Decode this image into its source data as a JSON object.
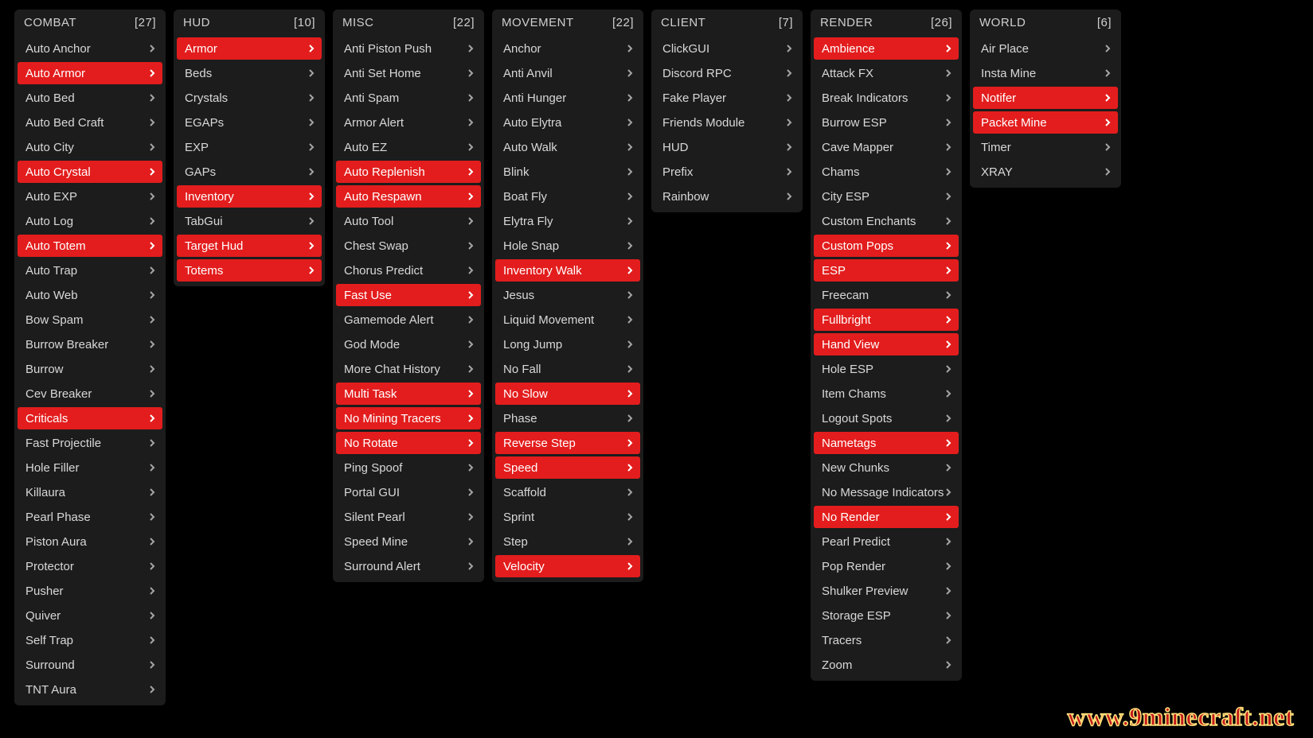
{
  "watermark": "www.9minecraft.net",
  "panels": [
    {
      "title": "COMBAT",
      "count": "[27]",
      "modules": [
        {
          "name": "Auto Anchor",
          "active": false,
          "chevron": true
        },
        {
          "name": "Auto Armor",
          "active": true,
          "chevron": true
        },
        {
          "name": "Auto Bed",
          "active": false,
          "chevron": true
        },
        {
          "name": "Auto Bed Craft",
          "active": false,
          "chevron": true
        },
        {
          "name": "Auto City",
          "active": false,
          "chevron": true
        },
        {
          "name": "Auto Crystal",
          "active": true,
          "chevron": true
        },
        {
          "name": "Auto EXP",
          "active": false,
          "chevron": true
        },
        {
          "name": "Auto Log",
          "active": false,
          "chevron": true
        },
        {
          "name": "Auto Totem",
          "active": true,
          "chevron": true
        },
        {
          "name": "Auto Trap",
          "active": false,
          "chevron": true
        },
        {
          "name": "Auto Web",
          "active": false,
          "chevron": true
        },
        {
          "name": "Bow Spam",
          "active": false,
          "chevron": true
        },
        {
          "name": "Burrow Breaker",
          "active": false,
          "chevron": true
        },
        {
          "name": "Burrow",
          "active": false,
          "chevron": true
        },
        {
          "name": "Cev Breaker",
          "active": false,
          "chevron": true
        },
        {
          "name": "Criticals",
          "active": true,
          "chevron": true
        },
        {
          "name": "Fast Projectile",
          "active": false,
          "chevron": true
        },
        {
          "name": "Hole Filler",
          "active": false,
          "chevron": true
        },
        {
          "name": "Killaura",
          "active": false,
          "chevron": true
        },
        {
          "name": "Pearl Phase",
          "active": false,
          "chevron": true
        },
        {
          "name": "Piston Aura",
          "active": false,
          "chevron": true
        },
        {
          "name": "Protector",
          "active": false,
          "chevron": true
        },
        {
          "name": "Pusher",
          "active": false,
          "chevron": true
        },
        {
          "name": "Quiver",
          "active": false,
          "chevron": true
        },
        {
          "name": "Self Trap",
          "active": false,
          "chevron": true
        },
        {
          "name": "Surround",
          "active": false,
          "chevron": true
        },
        {
          "name": "TNT Aura",
          "active": false,
          "chevron": true
        }
      ]
    },
    {
      "title": "HUD",
      "count": "[10]",
      "modules": [
        {
          "name": "Armor",
          "active": true,
          "chevron": true
        },
        {
          "name": "Beds",
          "active": false,
          "chevron": true
        },
        {
          "name": "Crystals",
          "active": false,
          "chevron": true
        },
        {
          "name": "EGAPs",
          "active": false,
          "chevron": true
        },
        {
          "name": "EXP",
          "active": false,
          "chevron": true
        },
        {
          "name": "GAPs",
          "active": false,
          "chevron": true
        },
        {
          "name": "Inventory",
          "active": true,
          "chevron": true
        },
        {
          "name": "TabGui",
          "active": false,
          "chevron": true
        },
        {
          "name": "Target Hud",
          "active": true,
          "chevron": true
        },
        {
          "name": "Totems",
          "active": true,
          "chevron": true
        }
      ]
    },
    {
      "title": "MISC",
      "count": "[22]",
      "modules": [
        {
          "name": "Anti Piston Push",
          "active": false,
          "chevron": true
        },
        {
          "name": "Anti Set Home",
          "active": false,
          "chevron": true
        },
        {
          "name": "Anti Spam",
          "active": false,
          "chevron": true
        },
        {
          "name": "Armor Alert",
          "active": false,
          "chevron": true
        },
        {
          "name": "Auto EZ",
          "active": false,
          "chevron": true
        },
        {
          "name": "Auto Replenish",
          "active": true,
          "chevron": true
        },
        {
          "name": "Auto Respawn",
          "active": true,
          "chevron": true
        },
        {
          "name": "Auto Tool",
          "active": false,
          "chevron": true
        },
        {
          "name": "Chest Swap",
          "active": false,
          "chevron": true
        },
        {
          "name": "Chorus Predict",
          "active": false,
          "chevron": true
        },
        {
          "name": "Fast Use",
          "active": true,
          "chevron": true
        },
        {
          "name": "Gamemode Alert",
          "active": false,
          "chevron": true
        },
        {
          "name": "God Mode",
          "active": false,
          "chevron": true
        },
        {
          "name": "More Chat History",
          "active": false,
          "chevron": true
        },
        {
          "name": "Multi Task",
          "active": true,
          "chevron": true
        },
        {
          "name": "No Mining Tracers",
          "active": true,
          "chevron": true
        },
        {
          "name": "No Rotate",
          "active": true,
          "chevron": true
        },
        {
          "name": "Ping Spoof",
          "active": false,
          "chevron": true
        },
        {
          "name": "Portal GUI",
          "active": false,
          "chevron": true
        },
        {
          "name": "Silent Pearl",
          "active": false,
          "chevron": true
        },
        {
          "name": "Speed Mine",
          "active": false,
          "chevron": true
        },
        {
          "name": "Surround Alert",
          "active": false,
          "chevron": true
        }
      ]
    },
    {
      "title": "MOVEMENT",
      "count": "[22]",
      "modules": [
        {
          "name": "Anchor",
          "active": false,
          "chevron": true
        },
        {
          "name": "Anti Anvil",
          "active": false,
          "chevron": true
        },
        {
          "name": "Anti Hunger",
          "active": false,
          "chevron": true
        },
        {
          "name": "Auto Elytra",
          "active": false,
          "chevron": true
        },
        {
          "name": "Auto Walk",
          "active": false,
          "chevron": true
        },
        {
          "name": "Blink",
          "active": false,
          "chevron": true
        },
        {
          "name": "Boat Fly",
          "active": false,
          "chevron": true
        },
        {
          "name": "Elytra Fly",
          "active": false,
          "chevron": true
        },
        {
          "name": "Hole Snap",
          "active": false,
          "chevron": true
        },
        {
          "name": "Inventory Walk",
          "active": true,
          "chevron": true
        },
        {
          "name": "Jesus",
          "active": false,
          "chevron": true
        },
        {
          "name": "Liquid Movement",
          "active": false,
          "chevron": true
        },
        {
          "name": "Long Jump",
          "active": false,
          "chevron": true
        },
        {
          "name": "No Fall",
          "active": false,
          "chevron": true
        },
        {
          "name": "No Slow",
          "active": true,
          "chevron": true
        },
        {
          "name": "Phase",
          "active": false,
          "chevron": true
        },
        {
          "name": "Reverse Step",
          "active": true,
          "chevron": true
        },
        {
          "name": "Speed",
          "active": true,
          "chevron": true
        },
        {
          "name": "Scaffold",
          "active": false,
          "chevron": true
        },
        {
          "name": "Sprint",
          "active": false,
          "chevron": true
        },
        {
          "name": "Step",
          "active": false,
          "chevron": true
        },
        {
          "name": "Velocity",
          "active": true,
          "chevron": true
        }
      ]
    },
    {
      "title": "CLIENT",
      "count": "[7]",
      "modules": [
        {
          "name": "ClickGUI",
          "active": false,
          "chevron": true
        },
        {
          "name": "Discord RPC",
          "active": false,
          "chevron": true
        },
        {
          "name": "Fake Player",
          "active": false,
          "chevron": true
        },
        {
          "name": "Friends Module",
          "active": false,
          "chevron": true
        },
        {
          "name": "HUD",
          "active": false,
          "chevron": true
        },
        {
          "name": "Prefix",
          "active": false,
          "chevron": true
        },
        {
          "name": "Rainbow",
          "active": false,
          "chevron": true
        }
      ]
    },
    {
      "title": "RENDER",
      "count": "[26]",
      "modules": [
        {
          "name": "Ambience",
          "active": true,
          "chevron": true
        },
        {
          "name": "Attack FX",
          "active": false,
          "chevron": true
        },
        {
          "name": "Break Indicators",
          "active": false,
          "chevron": true
        },
        {
          "name": "Burrow ESP",
          "active": false,
          "chevron": true
        },
        {
          "name": "Cave Mapper",
          "active": false,
          "chevron": true
        },
        {
          "name": "Chams",
          "active": false,
          "chevron": true
        },
        {
          "name": "City ESP",
          "active": false,
          "chevron": true
        },
        {
          "name": "Custom Enchants",
          "active": false,
          "chevron": true
        },
        {
          "name": "Custom Pops",
          "active": true,
          "chevron": true
        },
        {
          "name": "ESP",
          "active": true,
          "chevron": true
        },
        {
          "name": "Freecam",
          "active": false,
          "chevron": true
        },
        {
          "name": "Fullbright",
          "active": true,
          "chevron": true
        },
        {
          "name": "Hand View",
          "active": true,
          "chevron": true
        },
        {
          "name": "Hole ESP",
          "active": false,
          "chevron": true
        },
        {
          "name": "Item Chams",
          "active": false,
          "chevron": true
        },
        {
          "name": "Logout Spots",
          "active": false,
          "chevron": true
        },
        {
          "name": "Nametags",
          "active": true,
          "chevron": true
        },
        {
          "name": "New Chunks",
          "active": false,
          "chevron": true
        },
        {
          "name": "No Message Indicators",
          "active": false,
          "chevron": true
        },
        {
          "name": "No Render",
          "active": true,
          "chevron": true
        },
        {
          "name": "Pearl Predict",
          "active": false,
          "chevron": true
        },
        {
          "name": "Pop Render",
          "active": false,
          "chevron": true
        },
        {
          "name": "Shulker Preview",
          "active": false,
          "chevron": true
        },
        {
          "name": "Storage ESP",
          "active": false,
          "chevron": true
        },
        {
          "name": "Tracers",
          "active": false,
          "chevron": true
        },
        {
          "name": "Zoom",
          "active": false,
          "chevron": true
        }
      ]
    },
    {
      "title": "WORLD",
      "count": "[6]",
      "modules": [
        {
          "name": "Air Place",
          "active": false,
          "chevron": true
        },
        {
          "name": "Insta Mine",
          "active": false,
          "chevron": true
        },
        {
          "name": "Notifer",
          "active": true,
          "chevron": true
        },
        {
          "name": "Packet Mine",
          "active": true,
          "chevron": true
        },
        {
          "name": "Timer",
          "active": false,
          "chevron": true
        },
        {
          "name": "XRAY",
          "active": false,
          "chevron": true
        }
      ]
    }
  ]
}
